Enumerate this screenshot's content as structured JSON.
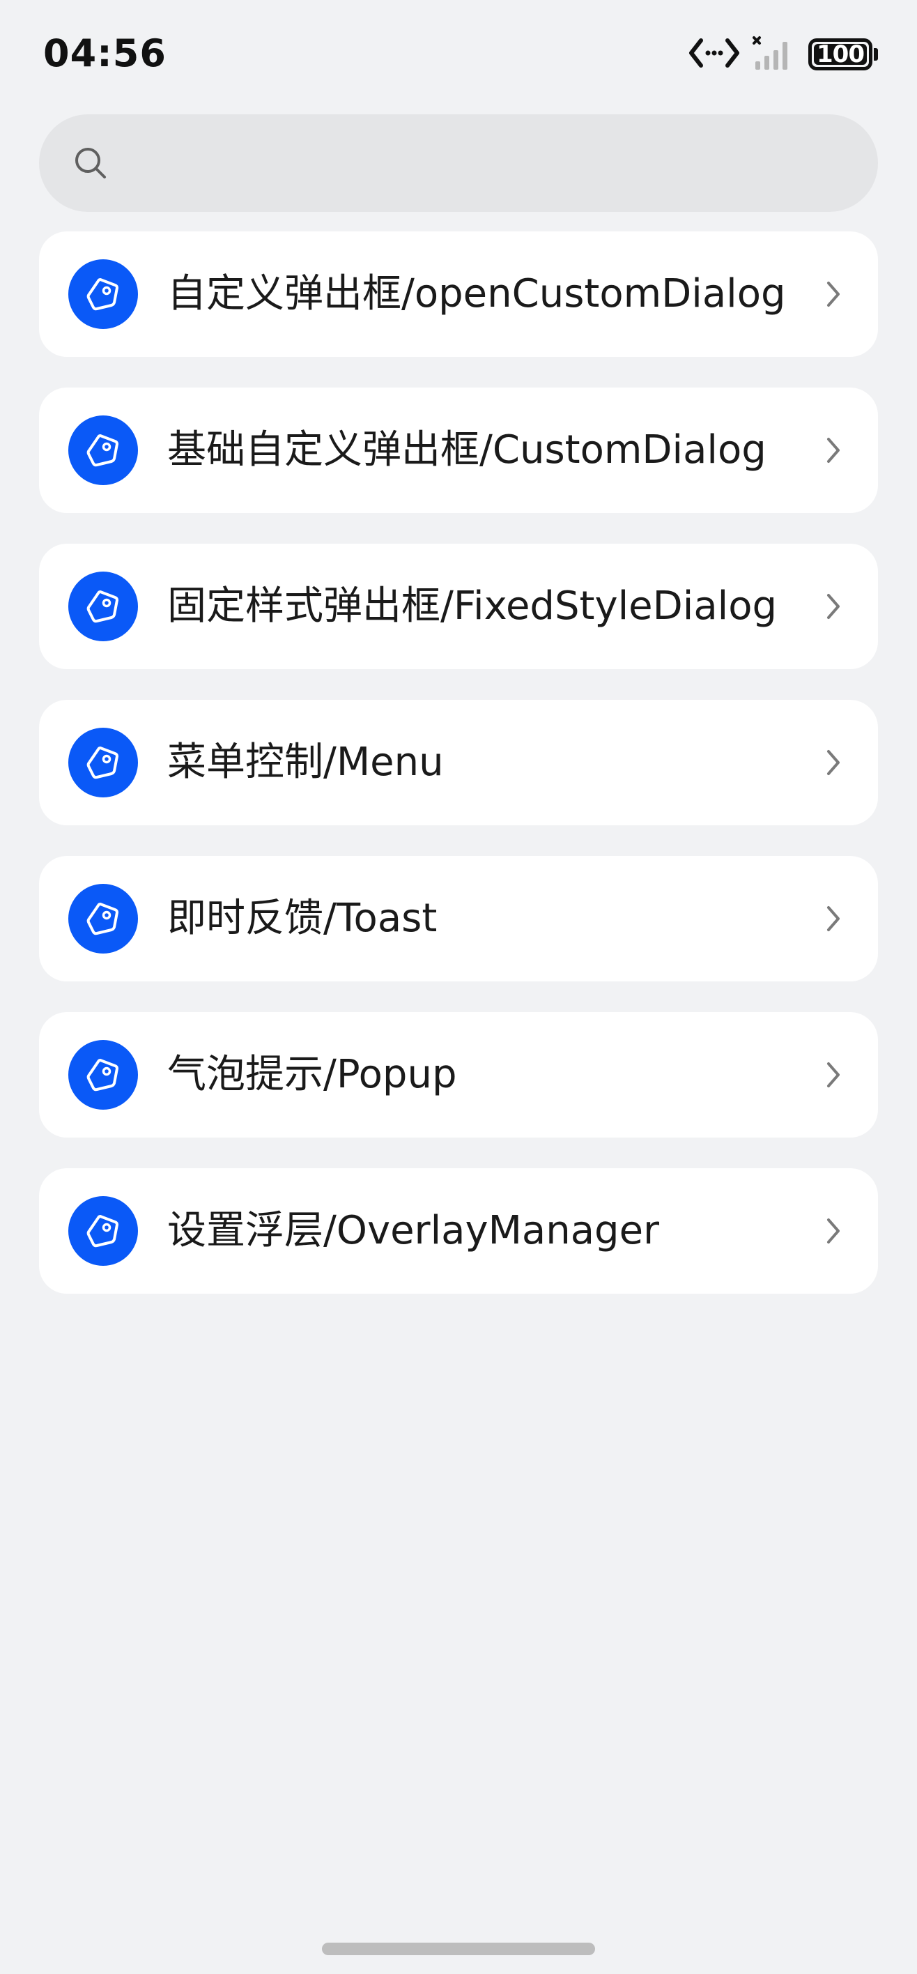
{
  "status_bar": {
    "time": "04:56",
    "battery": "100",
    "icons": [
      "data-transfer-icon",
      "signal-no-service-icon",
      "battery-icon"
    ]
  },
  "search": {
    "icon": "search-icon",
    "placeholder": "",
    "value": ""
  },
  "list": {
    "items": [
      {
        "label": "自定义弹出框/openCustomDialog",
        "icon": "tag-icon"
      },
      {
        "label": "基础自定义弹出框/CustomDialog",
        "icon": "tag-icon"
      },
      {
        "label": "固定样式弹出框/FixedStyleDialog",
        "icon": "tag-icon"
      },
      {
        "label": "菜单控制/Menu",
        "icon": "tag-icon"
      },
      {
        "label": "即时反馈/Toast",
        "icon": "tag-icon"
      },
      {
        "label": "气泡提示/Popup",
        "icon": "tag-icon"
      },
      {
        "label": "设置浮层/OverlayManager",
        "icon": "tag-icon"
      }
    ]
  },
  "colors": {
    "background": "#f1f2f4",
    "card": "#ffffff",
    "accent": "#0a59f7",
    "search_bg": "#e4e5e7"
  }
}
